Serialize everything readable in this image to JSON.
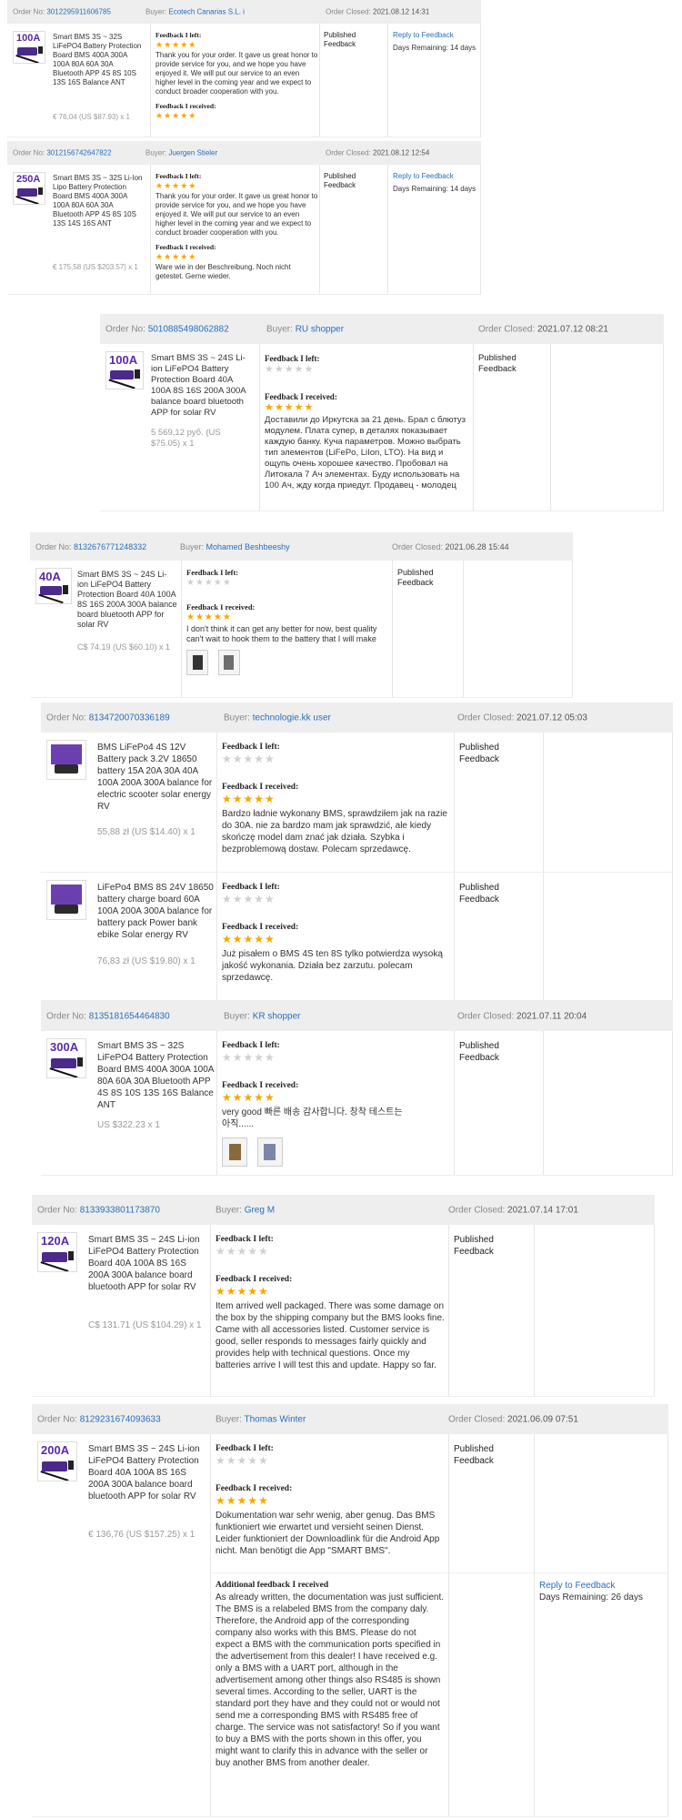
{
  "labels": {
    "order_no": "Order No:",
    "buyer": "Buyer:",
    "order_closed": "Order Closed:",
    "feedback_left": "Feedback I left:",
    "feedback_received": "Feedback I received:",
    "additional_feedback": "Additional feedback I received",
    "published_feedback": "Published Feedback",
    "reply": "Reply to Feedback"
  },
  "orders": [
    {
      "order_no": "3012295911606785",
      "buyer": "Ecotech Canarias S.L. i",
      "closed": "2021.08.12 14:31",
      "product": {
        "amp": "100A",
        "title": "Smart BMS 3S ~ 32S LiFePO4 Battery Protection Board BMS 400A 300A 100A 80A 60A 30A Bluetooth APP 4S 8S 10S 13S 16S Balance ANT",
        "price": "€ 76,04 (US $87.93) x 1"
      },
      "left_stars": "★★★★★",
      "left_text": "Thank you for your order. It gave us great honor to provide service for you, and we hope you have enjoyed it. We will put our service to an even higher level in the coming year and we expect to conduct broader cooperation with you.",
      "received_stars": "★★★★★",
      "received_text": "",
      "reply": "Reply to Feedback",
      "days": "Days Remaining: 14 days"
    },
    {
      "order_no": "3012156742647822",
      "buyer": "Juergen Stieler",
      "closed": "2021.08.12 12:54",
      "product": {
        "amp": "250A",
        "title": "Smart BMS 3S ~ 32S Li-Ion Lipo Battery Protection Board BMS 400A 300A 100A 80A 60A 30A Bluetooth APP 4S 8S 10S 13S 14S 16S ANT",
        "price": "€ 175,58 (US $203.57) x 1"
      },
      "left_stars": "★★★★★",
      "left_text": "Thank you for your order. It gave us great honor to provide service for you, and we hope you have enjoyed it. We will put our service to an even higher level in the coming year and we expect to conduct broader cooperation with you.",
      "received_stars": "★★★★★",
      "received_text": "Ware wie in der Beschreibung. Noch nicht getestet. Gerne wieder.",
      "reply": "Reply to Feedback",
      "days": "Days Remaining: 14 days"
    },
    {
      "order_no": "5010885498062882",
      "buyer": "RU shopper",
      "closed": "2021.07.12 08:21",
      "product": {
        "amp": "100A",
        "title": "Smart BMS 3S ~ 24S Li-ion LiFePO4 Battery Protection Board 40A 100A 8S 16S 200A 300A balance board bluetooth APP for solar RV",
        "price": "5 569,12 руб. (US $75.05) x 1"
      },
      "left_stars": "★★★★★",
      "received_stars": "★★★★★",
      "received_text": "Доставили до Иркутска за 21 день. Брал с блютуз модулем. Плата супер, в деталях показывает каждую банку. Куча параметров. Можно выбрать тип элементов (LiFePo, LiIon, LTO). На вид и ощупь очень хорошее качество. Пробовал на Литокала 7 Ач элементах. Буду использовать на 100 Ач, жду когда приедут. Продавец - молодец"
    },
    {
      "order_no": "8132676771248332",
      "buyer": "Mohamed Beshbeeshy",
      "closed": "2021.06.28 15:44",
      "product": {
        "amp": "40A",
        "title": "Smart BMS 3S ~ 24S Li-ion LiFePO4 Battery Protection Board 40A 100A 8S 16S 200A 300A balance board bluetooth APP for solar RV",
        "price": "C$ 74.19 (US $60.10) x 1"
      },
      "left_stars": "★★★★★",
      "received_stars": "★★★★★",
      "received_text": "I don't think it can get any better for now, best quality can't wait to hook them to the battery that I will make"
    },
    {
      "order_no": "8134720070336189",
      "buyer": "technologie.kk user",
      "closed": "2021.07.12 05:03",
      "items": [
        {
          "title": "BMS LiFePo4 4S 12V Battery pack 3.2V 18650 battery 15A 20A 30A 40A 100A 200A 300A balance for electric scooter solar energy RV",
          "price": "55,88 zł (US $14.40) x 1",
          "left_stars": "★★★★★",
          "received_stars": "★★★★★",
          "received_text": "Bardzo ładnie wykonany BMS, sprawdziłem jak na razie do 30A. nie za bardzo mam jak sprawdzić, ale kiedy skończę model dam znać jak działa. Szybka i bezproblemową dostaw. Polecam sprzedawcę."
        },
        {
          "title": "LiFePo4 BMS 8S 24V 18650 battery charge board 60A 100A 200A 300A balance for battery pack Power bank ebike Solar energy RV",
          "price": "76,83 zł (US $19.80) x 1",
          "left_stars": "★★★★★",
          "received_stars": "★★★★★",
          "received_text": "Już pisałem o BMS 4S ten 8S tylko potwierdza wysoką jakość wykonania. Działa bez zarzutu. polecam sprzedawcę."
        }
      ]
    },
    {
      "order_no": "8135181654464830",
      "buyer": "KR shopper",
      "closed": "2021.07.11 20:04",
      "product": {
        "amp": "300A",
        "title": "Smart BMS 3S ~ 32S LiFePO4 Battery Protection Board BMS 400A 300A 100A 80A 60A 30A Bluetooth APP 4S 8S 10S 13S 16S Balance ANT",
        "price": "US $322.23 x 1"
      },
      "left_stars": "★★★★★",
      "received_stars": "★★★★★",
      "received_text": "very good 빠른 배송 감사합니다. 창착 테스트는 아직......"
    },
    {
      "order_no": "8133933801173870",
      "buyer": "Greg M",
      "closed": "2021.07.14 17:01",
      "product": {
        "amp": "120A",
        "title": "Smart BMS 3S ~ 24S Li-ion LiFePO4 Battery Protection Board 40A 100A 8S 16S 200A 300A balance board bluetooth APP for solar RV",
        "price": "C$ 131.71 (US $104.29) x 1"
      },
      "left_stars": "★★★★★",
      "received_stars": "★★★★★",
      "received_text": "Item arrived well packaged. There was some damage on the box by the shipping company but the BMS looks fine. Came with all accessories listed. Customer service is good, seller responds to messages fairly quickly and provides help with technical questions. Once my batteries arrive I will test this and update. Happy so far."
    },
    {
      "order_no": "8129231674093633",
      "buyer": "Thomas Winter",
      "closed": "2021.06.09 07:51",
      "product": {
        "amp": "200A",
        "title": "Smart BMS 3S ~ 24S Li-ion LiFePO4 Battery Protection Board 40A 100A 8S 16S 200A 300A balance board bluetooth APP for solar RV",
        "price": "€ 136,76 (US $157.25) x 1"
      },
      "left_stars": "★★★★★",
      "received_stars": "★★★★★",
      "received_text": "Dokumentation war sehr wenig, aber genug. Das BMS funktioniert wie erwartet und versieht seinen Dienst. Leider funktioniert der Downloadlink für die Android App nicht. Man benötigt die App \"SMART BMS\".",
      "additional_text": "As already written, the documentation was just sufficient. The BMS is a relabeled BMS from the company daly. Therefore, the Android app of the corresponding company also works with this BMS. Please do not expect a BMS with the communication ports specified in the advertisement from this dealer! I have received e.g. only a BMS with a UART port, although in the advertisement among other things also RS485 is shown several times. According to the seller, UART is the standard port they have and they could not or would not send me a corresponding BMS with RS485 free of charge. The service was not satisfactory! So if you want to buy a BMS with the ports shown in this offer, you might want to clarify this in advance with the seller or buy another BMS from another dealer.",
      "reply": "Reply to Feedback",
      "days": "Days Remaining: 26 days"
    }
  ]
}
